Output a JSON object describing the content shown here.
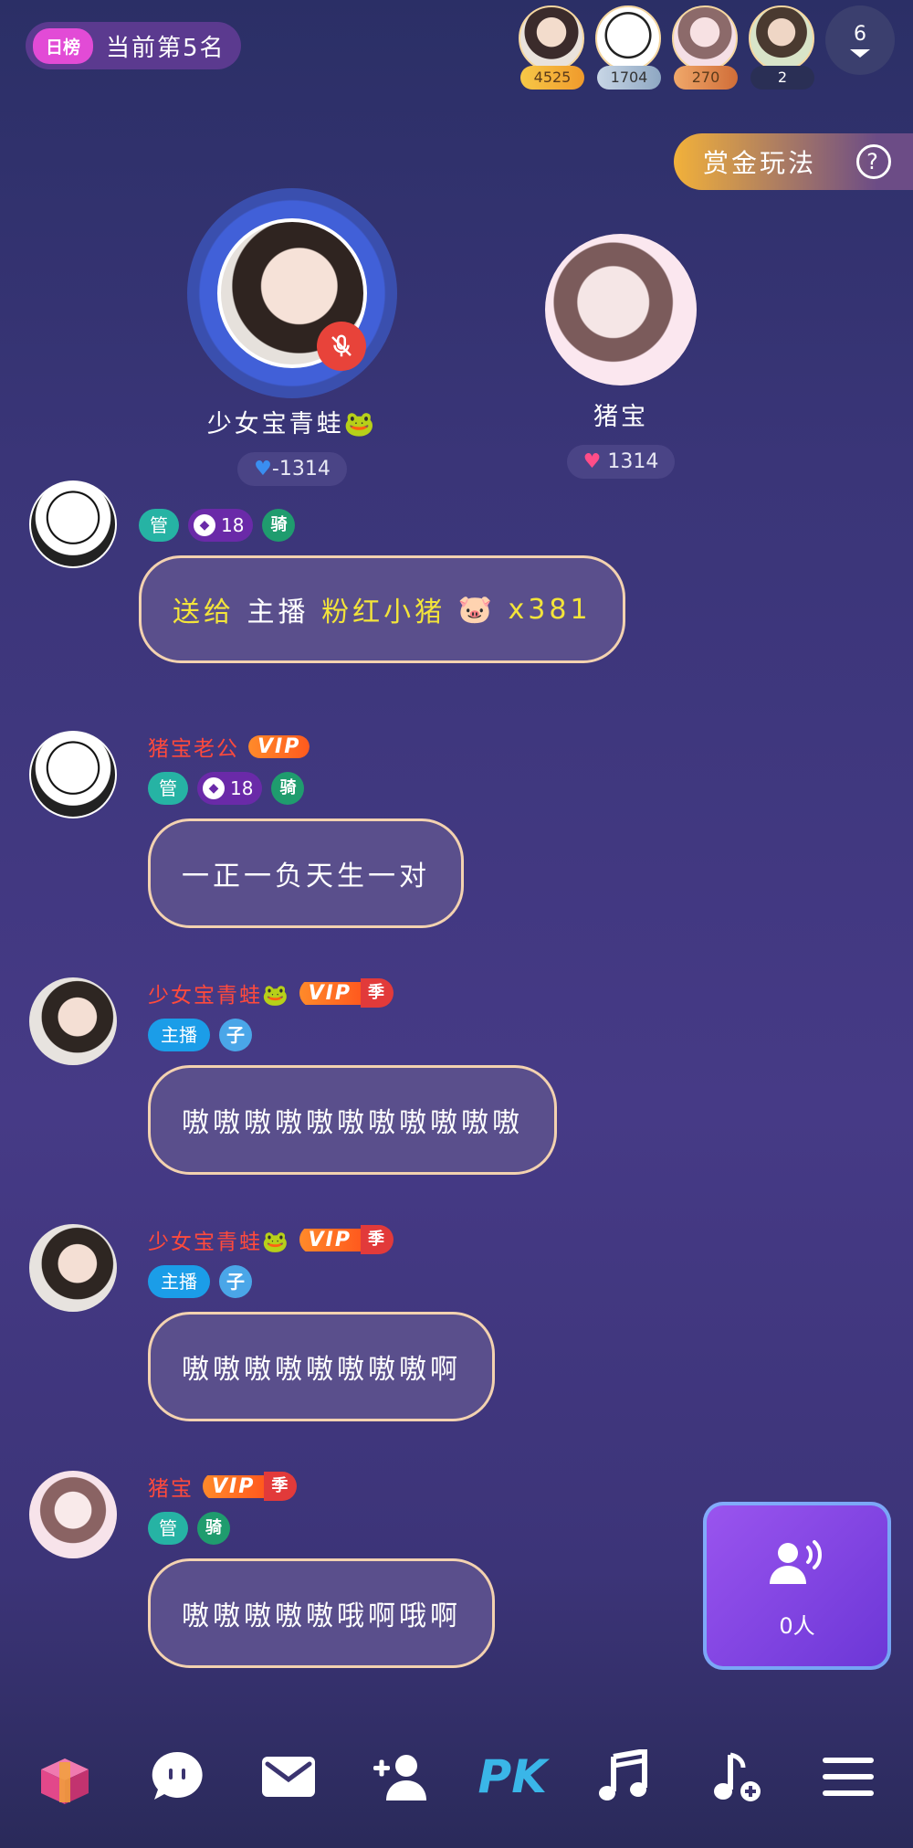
{
  "top": {
    "rank_tag": "日榜",
    "rank_text": "当前第5名",
    "viewers": [
      {
        "score": "4525",
        "avatar": "girl-avatar"
      },
      {
        "score": "1704",
        "avatar": "bear-avatar"
      },
      {
        "score": "270",
        "avatar": "pink-girl-avatar"
      },
      {
        "score": "2",
        "avatar": "girl-avatar-2"
      }
    ],
    "viewer_count": "6",
    "bounty_label": "赏金玩法",
    "help_icon": "?"
  },
  "seats": [
    {
      "name": "少女宝青蛙🐸",
      "charm": "-1314",
      "heart_color": "#3a8ef0",
      "muted": true
    },
    {
      "name": "猪宝",
      "charm": "1314",
      "heart_color": "#ff4d88",
      "muted": false
    }
  ],
  "messages": [
    {
      "gift_send": "送给",
      "gift_target": "主播",
      "gift_name": "粉红小猪",
      "gift_icon": "🐷",
      "gift_count": "x381",
      "badges": {
        "guan": "管",
        "lv": "18",
        "qi": "骑"
      }
    },
    {
      "user": "猪宝老公",
      "vip": "VIP",
      "badges": {
        "guan": "管",
        "lv": "18",
        "qi": "骑"
      },
      "text": "一正一负天生一对"
    },
    {
      "user": "少女宝青蛙🐸",
      "vip": "VIP",
      "vip_season": "季",
      "badges": {
        "zhubo": "主播",
        "zi": "子"
      },
      "text": "嗷嗷嗷嗷嗷嗷嗷嗷嗷嗷嗷"
    },
    {
      "user": "少女宝青蛙🐸",
      "vip": "VIP",
      "vip_season": "季",
      "badges": {
        "zhubo": "主播",
        "zi": "子"
      },
      "text": "嗷嗷嗷嗷嗷嗷嗷嗷啊"
    },
    {
      "user": "猪宝",
      "vip": "VIP",
      "vip_season": "季",
      "badges": {
        "guan": "管",
        "qi": "骑"
      },
      "text": "嗷嗷嗷嗷嗷哦啊哦啊"
    }
  ],
  "mic_card": {
    "count": "0人"
  },
  "bottom_bar": [
    "gift-box-icon",
    "chat-bubble-icon",
    "mail-icon",
    "add-user-icon",
    "PK",
    "music-icon",
    "add-music-icon",
    "menu-icon"
  ]
}
